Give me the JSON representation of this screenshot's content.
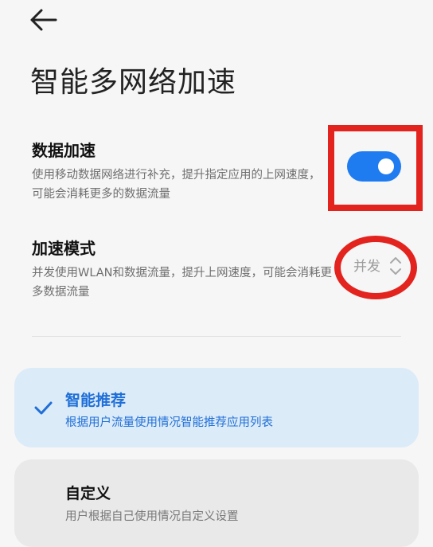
{
  "header": {
    "back_icon": "arrow-left-icon",
    "title": "智能多网络加速"
  },
  "settings": {
    "data_acceleration": {
      "title": "数据加速",
      "description": "使用移动数据网络进行补充，提升指定应用的上网速度，可能会消耗更多的数据流量",
      "enabled": true,
      "toggle_color": "#1f7bf0"
    },
    "acceleration_mode": {
      "title": "加速模式",
      "description": "并发使用WLAN和数据流量，提升上网速度，可能会消耗更多数据流量",
      "value": "并发",
      "icon": "chevron-updown-icon"
    }
  },
  "options": [
    {
      "title": "智能推荐",
      "description": "根据用户流量使用情况智能推荐应用列表",
      "selected": true
    },
    {
      "title": "自定义",
      "description": "用户根据自己使用情况自定义设置",
      "selected": false
    }
  ],
  "annotations": {
    "color": "#e3231e"
  }
}
